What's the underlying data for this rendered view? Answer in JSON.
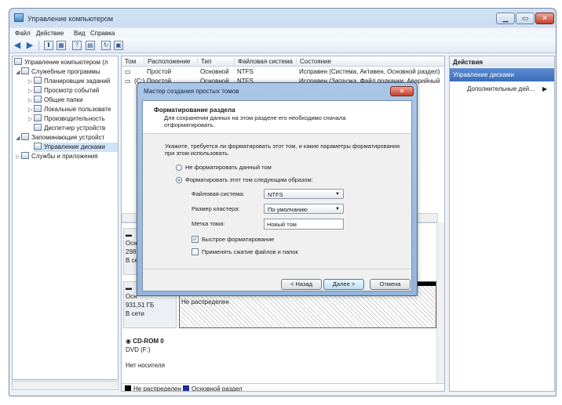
{
  "window": {
    "title": "Управление компьютером",
    "controls": {
      "minimize": "▁",
      "maximize": "▭",
      "close": "✕"
    }
  },
  "menu": {
    "items": [
      "Файл",
      "Действие",
      "Вид",
      "Справка"
    ]
  },
  "tree": {
    "items": [
      {
        "label": "Управление компьютером (л",
        "icon": "computer-icon"
      },
      {
        "label": "Служебные программы",
        "icon": "tools-icon"
      },
      {
        "label": "Планировщик заданий",
        "icon": "clock-icon"
      },
      {
        "label": "Просмотр событий",
        "icon": "event-viewer-icon"
      },
      {
        "label": "Общие папки",
        "icon": "shared-folder-icon"
      },
      {
        "label": "Локальные пользовате",
        "icon": "users-icon"
      },
      {
        "label": "Производительность",
        "icon": "performance-icon"
      },
      {
        "label": "Диспетчер устройств",
        "icon": "device-manager-icon"
      },
      {
        "label": "Запоминающие устройст",
        "icon": "storage-icon"
      },
      {
        "label": "Управление дисками",
        "icon": "disk-management-icon"
      },
      {
        "label": "Службы и приложения",
        "icon": "services-icon"
      }
    ]
  },
  "volumes": {
    "columns": [
      "Том",
      "Расположение",
      "Тип",
      "Файловая система",
      "Состояние"
    ],
    "rows": [
      {
        "vol": "",
        "layout": "Простой",
        "type": "Основной",
        "fs": "NTFS",
        "status": "Исправен (Система, Активен, Основной раздел)"
      },
      {
        "vol": "(C:)",
        "layout": "Простой",
        "type": "Основной",
        "fs": "NTFS",
        "status": "Исправен (Загрузка, Файл подкачки, Аварийный"
      }
    ]
  },
  "disks": {
    "disk0": {
      "lines": [
        "Осн",
        "298,",
        "В се"
      ]
    },
    "disk1": {
      "lines": [
        "Осн",
        "931,51 ГБ",
        "В сети"
      ],
      "part_size": "931,51 ГБ",
      "part_status": "Не распределен"
    },
    "cdrom": {
      "name": "CD-ROM 0",
      "drive": "DVD (F:)",
      "media": "Нет носителя"
    }
  },
  "legend": {
    "unallocated": "Не распределен",
    "primary": "Основной раздел"
  },
  "actions": {
    "header": "Действия",
    "section": "Управление дисками",
    "more": "Дополнительные дей..."
  },
  "dialog": {
    "title": "Мастер создания простых томов",
    "heading": "Форматирование раздела",
    "subheading": "Для сохранения данных на этом разделе его необходимо сначала отформатировать.",
    "prompt": "Укажите, требуется ли форматировать этот том, и какие параметры форматирования при этом использовать.",
    "radio_no_format": "Не форматировать данный том",
    "radio_format": "Форматировать этот том следующим образом:",
    "fs_label": "Файловая система:",
    "fs_value": "NTFS",
    "cluster_label": "Размер кластера:",
    "cluster_value": "По умолчанию",
    "volume_label_label": "Метка тома:",
    "volume_label_value": "Новый том",
    "quick_format": "Быстрое форматирование",
    "compression": "Применять сжатие файлов и папок",
    "back": "< Назад",
    "next": "Далее >",
    "cancel": "Отмена",
    "close": "✕"
  }
}
